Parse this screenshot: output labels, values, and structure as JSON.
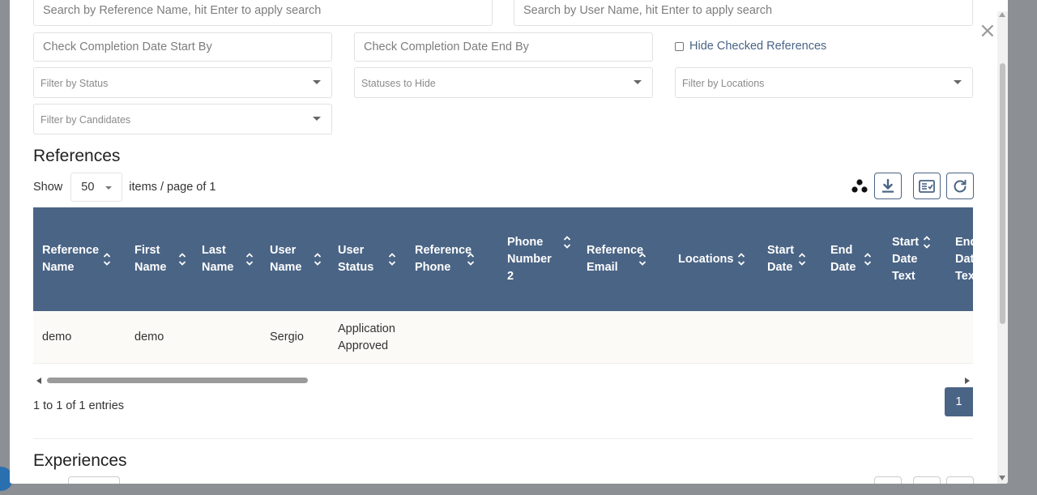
{
  "filters": {
    "reference_search_placeholder": "Search by Reference Name, hit Enter to apply search",
    "user_search_placeholder": "Search by User Name, hit Enter to apply search",
    "completion_start_placeholder": "Check Completion Date Start By",
    "completion_end_placeholder": "Check Completion Date End By",
    "hide_checked_label": "Hide Checked References",
    "status_placeholder": "Filter by Status",
    "statuses_hide_placeholder": "Statuses to Hide",
    "locations_placeholder": "Filter by Locations",
    "candidates_placeholder": "Filter by Candidates"
  },
  "references": {
    "title": "References",
    "show_label": "Show",
    "page_size": "50",
    "items_label": "items / page of 1",
    "columns": [
      "Reference\nName",
      "First\nName",
      "Last\nName",
      "User\nName",
      "User\nStatus",
      "Reference\nPhone",
      "Phone\nNumber\n2",
      "Reference\nEmail",
      "Locations",
      "Start\nDate",
      "End\nDate",
      "Start\nDate\nText",
      "End\nDate\nText"
    ],
    "rows": [
      {
        "reference_name": "demo",
        "first_name": "demo",
        "last_name": "",
        "user_name": "Sergio",
        "user_status": "Application\nApproved"
      }
    ],
    "entries_text": "1 to 1 of 1 entries",
    "current_page": "1"
  },
  "experiences": {
    "title": "Experiences"
  },
  "icons": {
    "close": "×"
  },
  "colors": {
    "header_bg": "#4a6485",
    "accent": "#4a6485"
  }
}
